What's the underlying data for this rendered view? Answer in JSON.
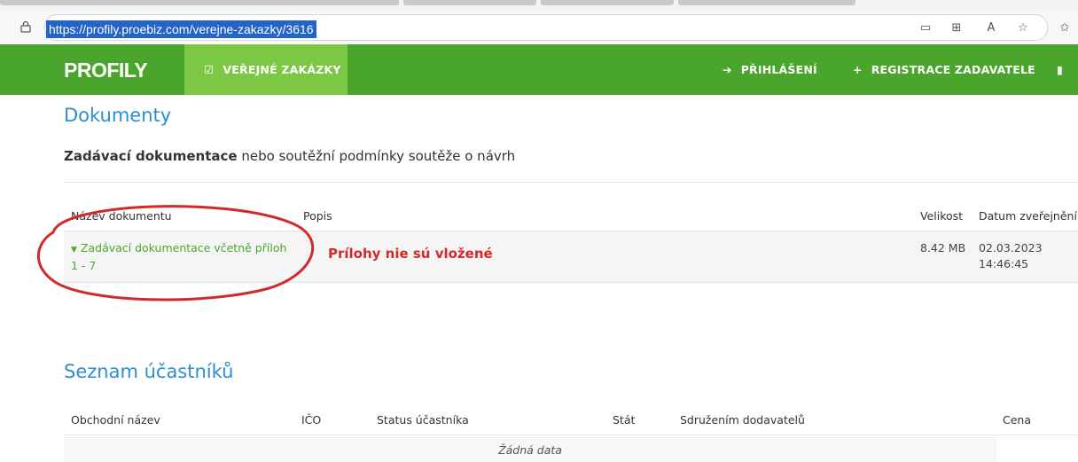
{
  "browser": {
    "url": "https://profily.proebiz.com/verejne-zakazky/3616",
    "icons": [
      "lock-icon",
      "reader-view-icon",
      "app-available-icon",
      "read-aloud-icon",
      "favorite-add-icon",
      "favorites-icon"
    ]
  },
  "navbar": {
    "logo": "PROFILY",
    "active_item": "VEŘEJNÉ ZAKÁZKY",
    "login": "PŘIHLÁŠENÍ",
    "register": "REGISTRACE ZADAVATELE"
  },
  "documents": {
    "heading": "Dokumenty",
    "subtitle_bold": "Zadávací dokumentace",
    "subtitle_rest": " nebo soutěžní podmínky soutěže o návrh",
    "columns": [
      "Název dokumentu",
      "Popis",
      "Velikost",
      "Datum zveřejnění"
    ],
    "row": {
      "name": "Zadávací dokumentace včetně příloh 1 - 7",
      "description": "",
      "size": "8.42 MB",
      "date": "02.03.2023",
      "time": "14:46:45"
    },
    "annotation": "Prílohy nie sú vložené"
  },
  "participants": {
    "heading": "Seznam účastníků",
    "columns": [
      "Obchodní název",
      "IČO",
      "Status účastníka",
      "Stát",
      "Sdružením dodavatelů",
      "Cena"
    ],
    "empty_text": "Žádná data"
  },
  "colors": {
    "navbar": "#49a52c",
    "navbar_active": "#7cc844",
    "heading": "#2a8ed0",
    "link": "#4ca82c",
    "annotation": "#d12a2a"
  }
}
